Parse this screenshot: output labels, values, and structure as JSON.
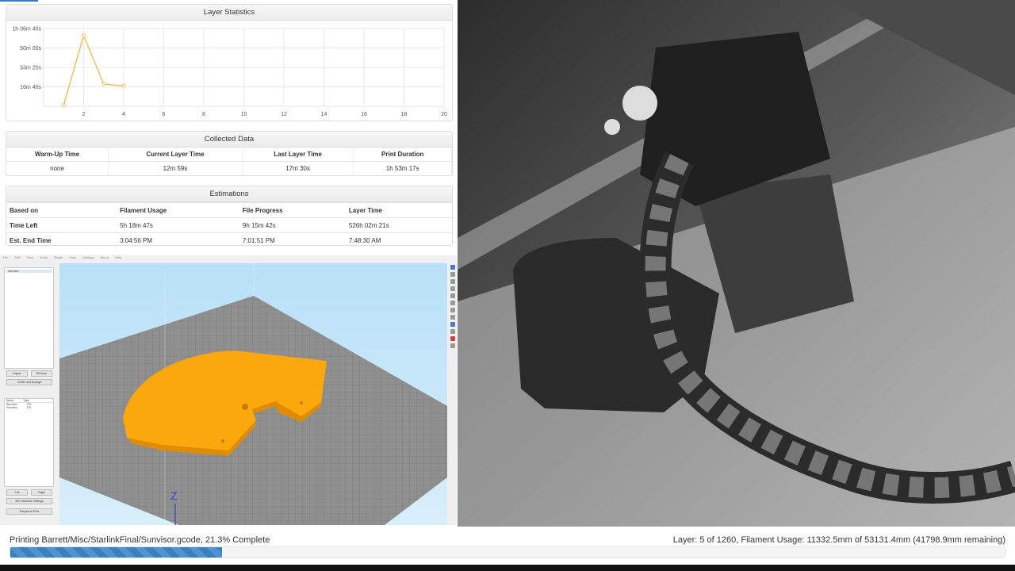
{
  "layer_stats": {
    "title": "Layer Statistics",
    "chart_data": {
      "type": "line",
      "x": [
        1,
        2,
        3,
        4
      ],
      "y_seconds": [
        60,
        3640,
        1145,
        1050
      ],
      "xlim": [
        0,
        20
      ],
      "xticks": [
        "2",
        "4",
        "6",
        "8",
        "10",
        "12",
        "14",
        "16",
        "18",
        "20"
      ],
      "ylim_seconds": [
        0,
        4000
      ],
      "yticks": [
        {
          "label": "16m 40s",
          "value": 1000
        },
        {
          "label": "33m 20s",
          "value": 2000
        },
        {
          "label": "50m 00s",
          "value": 3000
        },
        {
          "label": "1h 06m 40s",
          "value": 4000
        }
      ],
      "color": "#f0c060",
      "grid": true
    }
  },
  "collected": {
    "title": "Collected Data",
    "headers": [
      "Warm-Up Time",
      "Current Layer Time",
      "Last Layer Time",
      "Print Duration"
    ],
    "values": [
      "none",
      "12m 59s",
      "17m 30s",
      "1h 53m 17s"
    ]
  },
  "estimations": {
    "title": "Estimations",
    "headers": [
      "Based on",
      "Filament Usage",
      "File Progress",
      "Layer Time"
    ],
    "rows": [
      {
        "label": "Time Left",
        "cells": [
          "5h 18m 47s",
          "9h 15m 42s",
          "526h 02m 21s"
        ]
      },
      {
        "label": "Est. End Time",
        "cells": [
          "3:04:56 PM",
          "7:01:51 PM",
          "7:48:30 AM"
        ]
      }
    ]
  },
  "slicer": {
    "menu": [
      "File",
      "Edit",
      "View",
      "Tools",
      "Repair",
      "Help",
      "Settings",
      "About",
      "Help"
    ],
    "sidebar_item": "Sunvisor",
    "buttons": [
      "Import",
      "Remove",
      "Center and Arrange",
      "Left",
      "Right",
      "Set Transform Settings",
      "Prepare to Print"
    ],
    "table_headers": [
      "Name",
      "Type"
    ],
    "table_rows": [
      [
        "Sunvisor",
        "STL"
      ],
      [
        "Sunvisor",
        "STL"
      ]
    ],
    "axis_label": "Z",
    "model_color": "#fba70e"
  },
  "status": {
    "print_text": "Printing Barrett/Misc/StarlinkFinal/Sunvisor.gcode, 21.3% Complete",
    "layer_text": "Layer: 5 of 1260, Filament Usage: 11332.5mm of 53131.4mm (41798.9mm remaining)",
    "progress": 0.213
  }
}
